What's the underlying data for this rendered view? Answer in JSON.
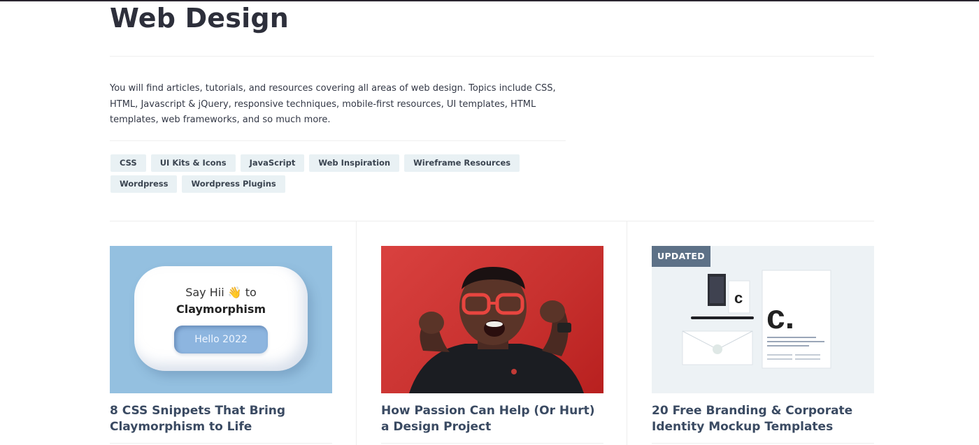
{
  "page": {
    "title": "Web Design",
    "intro": "You will find articles, tutorials, and resources covering all areas of web design. Topics include CSS, HTML, Javascript & jQuery, responsive techniques, mobile-first resources, UI templates, HTML templates, web frameworks, and so much more."
  },
  "tags": [
    "CSS",
    "UI Kits & Icons",
    "JavaScript",
    "Web Inspiration",
    "Wireframe Resources",
    "Wordpress",
    "Wordpress Plugins"
  ],
  "cards": [
    {
      "title": "8 CSS Snippets That Bring Claymorphism to Life",
      "thumb": {
        "line1": "Say Hii 👋 to",
        "line2": "Claymorphism",
        "button": "Hello 2022"
      }
    },
    {
      "title": "How Passion Can Help (Or Hurt) a Design Project"
    },
    {
      "title": "20 Free Branding & Corporate Identity Mockup Templates",
      "badge": "UPDATED"
    }
  ],
  "colors": {
    "accent": "#3a4a62",
    "tag_bg": "#e9f1f4",
    "badge_bg": "#5d7187"
  }
}
